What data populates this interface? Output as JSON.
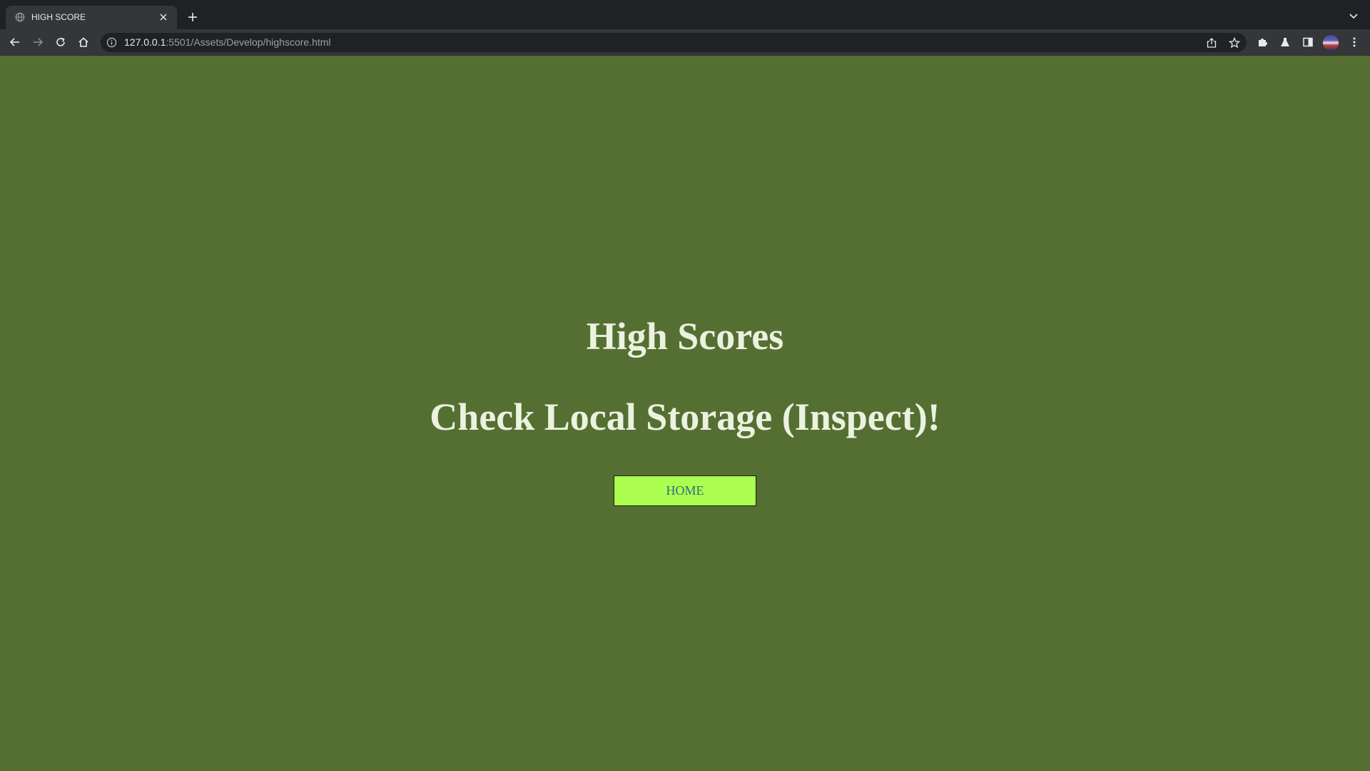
{
  "browser": {
    "tab_title": "HIGH SCORE",
    "url_host": "127.0.0.1",
    "url_rest": ":5501/Assets/Develop/highscore.html",
    "icons": {
      "tab_favicon": "globe-icon",
      "tab_close": "close-icon",
      "new_tab": "plus-icon",
      "tab_search": "chevron-down-icon",
      "back": "back-arrow-icon",
      "forward": "forward-arrow-icon",
      "reload": "reload-icon",
      "home": "home-icon",
      "site_info": "info-icon",
      "share": "share-icon",
      "bookmark": "star-icon",
      "extensions": "puzzle-icon",
      "labs": "flask-icon",
      "side_panel": "side-panel-icon",
      "profile": "avatar",
      "menu": "kebab-menu-icon"
    }
  },
  "page": {
    "heading": "High Scores",
    "subheading": "Check Local Storage (Inspect)!",
    "home_button_label": "HOME"
  },
  "colors": {
    "page_background": "#556f33",
    "heading_text": "#ebf2e0",
    "button_background": "#adff4f",
    "button_text": "#2a6f7a"
  }
}
